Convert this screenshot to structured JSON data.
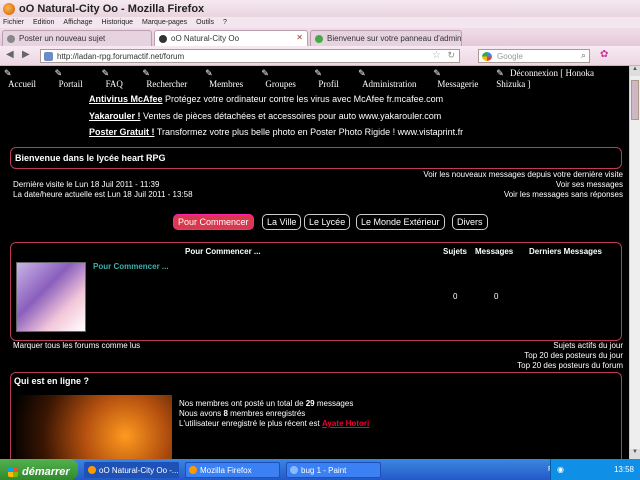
{
  "window": {
    "title": "oO Natural-City Oo - Mozilla Firefox"
  },
  "menu": [
    "Fichier",
    "Edition",
    "Affichage",
    "Historique",
    "Marque-pages",
    "Outils",
    "?"
  ],
  "tabs": [
    {
      "label": "Poster un nouveau sujet",
      "active": false
    },
    {
      "label": "oO Natural-City Oo",
      "active": true
    },
    {
      "label": "Bienvenue sur votre panneau d'adminis...",
      "active": false
    }
  ],
  "url": "http://ladan-rpg.forumactif.net/forum",
  "search_placeholder": "Google",
  "nav": [
    "Accueil",
    "Portail",
    "FAQ",
    "Rechercher",
    "Membres",
    "Groupes",
    "Profil",
    "Administration",
    "Messagerie",
    "Déconnexion [ Honoka Shizuka ]"
  ],
  "ads": [
    {
      "title": "Antivirus McAfee",
      "text": " Protégez votre ordinateur contre les virus avec McAfee fr.mcafee.com"
    },
    {
      "title": "Yakarouler !",
      "text": " Ventes de pièces détachées et accessoires pour auto www.yakarouler.com"
    },
    {
      "title": "Poster Gratuit !",
      "text": " Transformez votre plus belle photo en Poster Photo Rigide ! www.vistaprint.fr"
    }
  ],
  "welcome": {
    "title": "Bienvenue dans le lycée heart RPG"
  },
  "visit": {
    "last": "Dernière visite le Lun 18 Juil 2011 - 11:39",
    "now": "La date/heure actuelle est Lun 18 Juil 2011 - 13:58"
  },
  "visit_links": [
    "Voir les nouveaux messages depuis votre dernière visite",
    "Voir ses messages",
    "Voir les messages sans réponses"
  ],
  "categories": [
    {
      "label": "Pour Commencer",
      "active": true
    },
    {
      "label": "La Ville",
      "active": false
    },
    {
      "label": "Le Lycée",
      "active": false
    },
    {
      "label": "Le Monde Extérieur",
      "active": false
    },
    {
      "label": "Divers",
      "active": false
    }
  ],
  "forum_table": {
    "headers": [
      "Pour Commencer ...",
      "Sujets",
      "Messages",
      "Derniers Messages"
    ],
    "forum_name": "Pour Commencer ...",
    "topics": "0",
    "messages": "0"
  },
  "mark_read": "Marquer tous les forums comme lus",
  "stats_links": [
    "Sujets actifs du jour",
    "Top 20 des posteurs du jour",
    "Top 20 des posteurs du forum"
  ],
  "online": {
    "title": "Qui est en ligne ?",
    "line1_pre": "Nos membres ont posté un total de ",
    "line1_num": "29",
    "line1_post": " messages",
    "line2_pre": "Nous avons ",
    "line2_num": "8",
    "line2_post": " membres enregistrés",
    "line3_pre": "L'utilisateur enregistré le plus récent est ",
    "newest": "Ayate Hotori"
  },
  "taskbar": {
    "start": "démarrer",
    "items": [
      {
        "label": "oO Natural-City Oo -..."
      },
      {
        "label": "Mozilla Firefox"
      },
      {
        "label": "bug 1 - Paint"
      }
    ],
    "lang": "FR",
    "time": "13:58"
  }
}
